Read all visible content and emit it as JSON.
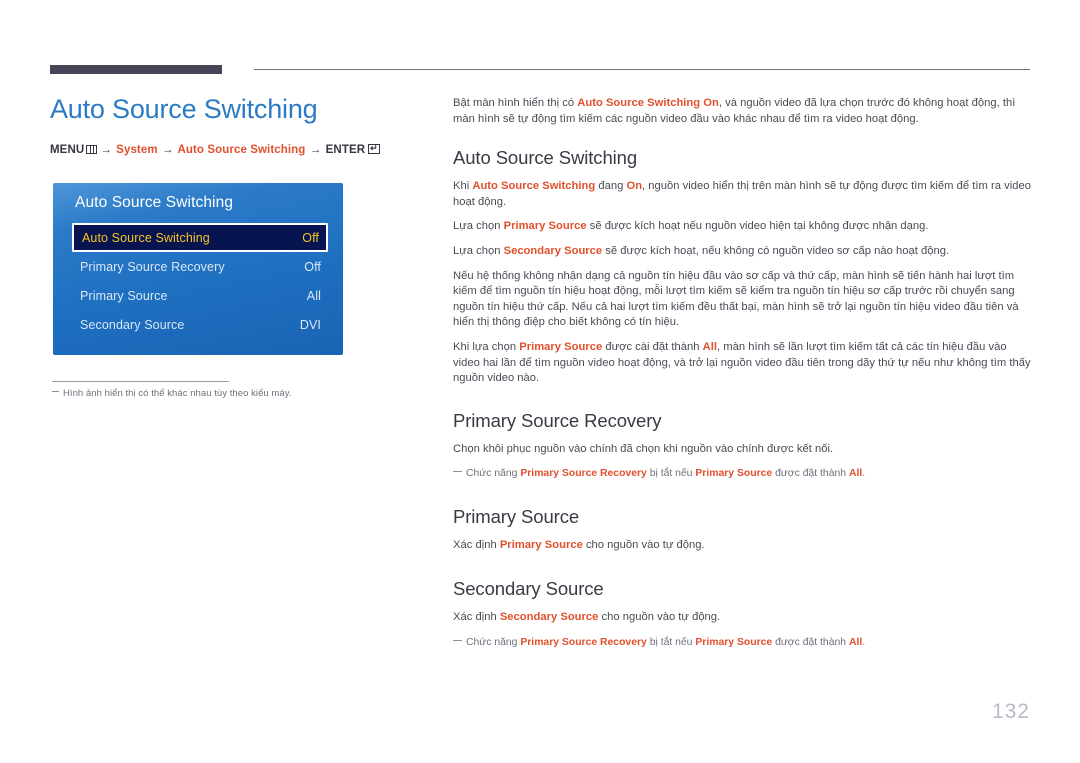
{
  "page_title": "Auto Source Switching",
  "page_number": "132",
  "colors": {
    "title_blue": "#2b7bc4",
    "accent_orange": "#e1502d",
    "rule_dark": "#474458",
    "osd_blue": "#1e6fc0",
    "osd_selected_bg": "#071450",
    "osd_selected_text": "#f6c522"
  },
  "menu_path": {
    "prefix": "MENU",
    "menu_icon": "menu-grid-icon",
    "arrow": "→",
    "step1": "System",
    "step2": "Auto Source Switching",
    "enter": "ENTER",
    "enter_icon": "enter-key-icon"
  },
  "osd": {
    "title": "Auto Source Switching",
    "rows": [
      {
        "label": "Auto Source Switching",
        "value": "Off",
        "selected": true
      },
      {
        "label": "Primary Source Recovery",
        "value": "Off",
        "selected": false
      },
      {
        "label": "Primary Source",
        "value": "All",
        "selected": false
      },
      {
        "label": "Secondary Source",
        "value": "DVI",
        "selected": false
      }
    ]
  },
  "left_note": "Hình ảnh hiển thị có thể khác nhau tùy theo kiểu máy.",
  "intro": {
    "t1": "Bật màn hình hiển thị có ",
    "h1": "Auto Source Switching On",
    "t2": ", và nguồn video đã lựa chọn trước đó không hoạt động, thì màn hình sẽ tự động tìm kiếm các nguồn video đầu vào khác nhau để tìm ra video hoạt động."
  },
  "sections": [
    {
      "heading": "Auto Source Switching",
      "paragraphs": [
        {
          "parts": [
            {
              "type": "text",
              "v": "Khi "
            },
            {
              "type": "hl",
              "v": "Auto Source Switching"
            },
            {
              "type": "text",
              "v": " đang "
            },
            {
              "type": "hl",
              "v": "On"
            },
            {
              "type": "text",
              "v": ", nguồn video hiển thị trên màn hình sẽ tự động được tìm kiếm để tìm ra video hoạt động."
            }
          ]
        },
        {
          "parts": [
            {
              "type": "text",
              "v": "Lựa chọn "
            },
            {
              "type": "hl",
              "v": "Primary Source"
            },
            {
              "type": "text",
              "v": " sẽ được kích hoạt nếu nguồn video hiện tại không được nhận dạng."
            }
          ]
        },
        {
          "parts": [
            {
              "type": "text",
              "v": "Lựa chọn "
            },
            {
              "type": "hl",
              "v": "Secondary Source"
            },
            {
              "type": "text",
              "v": " sẽ được kích hoạt, nếu không có nguồn video sơ cấp nào hoạt động."
            }
          ]
        },
        {
          "parts": [
            {
              "type": "text",
              "v": "Nếu hệ thống không nhận dạng cả nguồn tín hiệu đầu vào sơ cấp và thứ cấp, màn hình sẽ tiến hành hai lượt tìm kiếm để tìm nguồn tín hiệu hoạt động, mỗi lượt tìm kiếm sẽ kiểm tra nguồn tín hiệu sơ cấp trước rồi chuyển sang nguồn tín hiệu thứ cấp. Nếu cả hai lượt tìm kiếm đều thất bại, màn hình sẽ trở lại nguồn tín hiệu video đầu tiên và hiển thị thông điệp cho biết không có tín hiệu."
            }
          ]
        },
        {
          "parts": [
            {
              "type": "text",
              "v": "Khi lựa chọn "
            },
            {
              "type": "hl",
              "v": "Primary Source"
            },
            {
              "type": "text",
              "v": " được cài đặt thành "
            },
            {
              "type": "hl",
              "v": "All"
            },
            {
              "type": "text",
              "v": ", màn hình sẽ lần lượt tìm kiếm tất cả các tín hiệu đầu vào video hai lần để tìm nguồn video hoạt động, và trở lại nguồn video đầu tiên trong dãy thứ tự nếu như không tìm thấy nguồn video nào."
            }
          ]
        }
      ],
      "notes": []
    },
    {
      "heading": "Primary Source Recovery",
      "paragraphs": [
        {
          "parts": [
            {
              "type": "text",
              "v": "Chọn khôi phục nguồn vào chính đã chọn khi nguồn vào chính được kết nối."
            }
          ]
        }
      ],
      "notes": [
        {
          "parts": [
            {
              "type": "dash",
              "v": ""
            },
            {
              "type": "text",
              "v": "Chức năng "
            },
            {
              "type": "hl",
              "v": "Primary Source Recovery"
            },
            {
              "type": "text",
              "v": " bị tắt nếu "
            },
            {
              "type": "hl",
              "v": "Primary Source"
            },
            {
              "type": "text",
              "v": " được đặt thành "
            },
            {
              "type": "hl",
              "v": "All"
            },
            {
              "type": "text",
              "v": "."
            }
          ]
        }
      ]
    },
    {
      "heading": "Primary Source",
      "paragraphs": [
        {
          "parts": [
            {
              "type": "text",
              "v": "Xác định "
            },
            {
              "type": "hl",
              "v": "Primary Source"
            },
            {
              "type": "text",
              "v": " cho nguồn vào tự động."
            }
          ]
        }
      ],
      "notes": []
    },
    {
      "heading": "Secondary Source",
      "paragraphs": [
        {
          "parts": [
            {
              "type": "text",
              "v": "Xác định "
            },
            {
              "type": "hl",
              "v": "Secondary Source"
            },
            {
              "type": "text",
              "v": " cho nguồn vào tự động."
            }
          ]
        }
      ],
      "notes": [
        {
          "parts": [
            {
              "type": "dash",
              "v": ""
            },
            {
              "type": "text",
              "v": "Chức năng "
            },
            {
              "type": "hl",
              "v": "Primary Source Recovery"
            },
            {
              "type": "text",
              "v": " bị tắt nếu "
            },
            {
              "type": "hl",
              "v": "Primary Source"
            },
            {
              "type": "text",
              "v": " được đặt thành "
            },
            {
              "type": "hl",
              "v": "All"
            },
            {
              "type": "text",
              "v": "."
            }
          ]
        }
      ]
    }
  ]
}
